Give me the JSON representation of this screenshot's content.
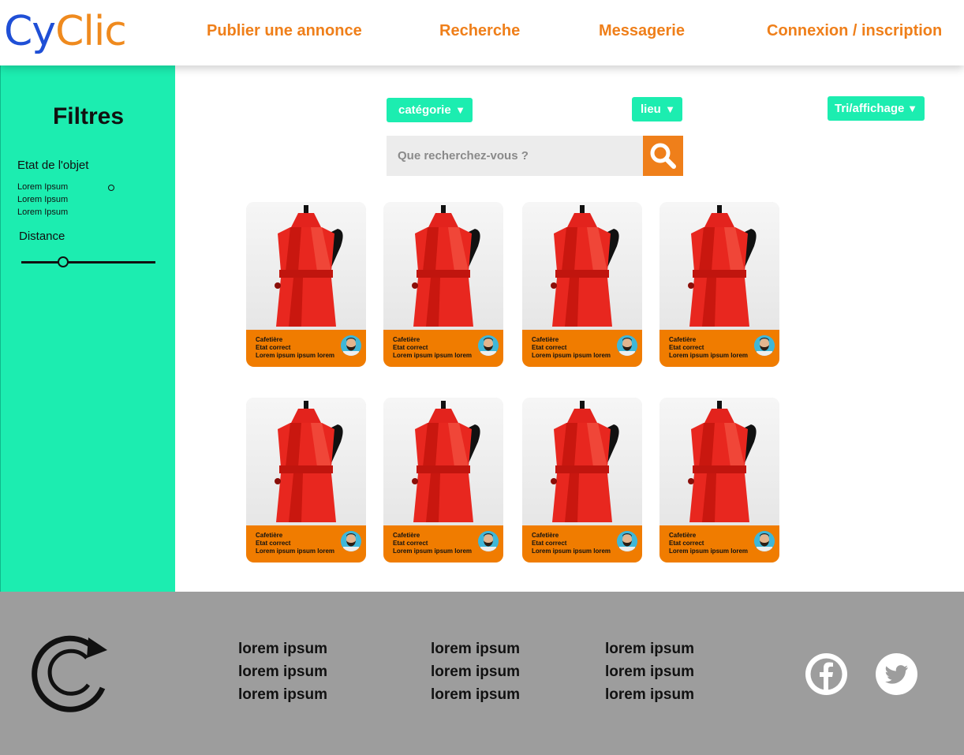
{
  "header": {
    "logo_cy": "Cy",
    "logo_clic": "Clic",
    "nav": [
      {
        "label": "Publier une annonce"
      },
      {
        "label": "Recherche"
      },
      {
        "label": "Messagerie"
      },
      {
        "label": "Connexion / inscription"
      }
    ]
  },
  "sidebar": {
    "title": "Filtres",
    "condition_label": "Etat de l'objet",
    "condition_options": [
      "Lorem Ipsum",
      "Lorem Ipsum",
      "Lorem Ipsum"
    ],
    "distance_label": "Distance",
    "distance_value": 0.31
  },
  "toolbar": {
    "category": "catégorie",
    "location": "lieu",
    "sort": "Tri/affichage"
  },
  "search": {
    "placeholder": "Que recherchez-vous ?"
  },
  "listings": [
    {
      "name": "Cafetière",
      "condition": "Etat correct",
      "desc": "Lorem ipsum ipsum lorem"
    },
    {
      "name": "Cafetière",
      "condition": "Etat correct",
      "desc": "Lorem ipsum ipsum lorem"
    },
    {
      "name": "Cafetière",
      "condition": "Etat correct",
      "desc": "Lorem ipsum ipsum lorem"
    },
    {
      "name": "Cafetière",
      "condition": "Etat correct",
      "desc": "Lorem ipsum ipsum lorem"
    },
    {
      "name": "Cafetière",
      "condition": "Etat correct",
      "desc": "Lorem ipsum ipsum lorem"
    },
    {
      "name": "Cafetière",
      "condition": "Etat correct",
      "desc": "Lorem ipsum ipsum lorem"
    },
    {
      "name": "Cafetière",
      "condition": "Etat correct",
      "desc": "Lorem ipsum ipsum lorem"
    },
    {
      "name": "Cafetière",
      "condition": "Etat correct",
      "desc": "Lorem ipsum ipsum lorem"
    }
  ],
  "footer": {
    "columns": [
      [
        "lorem ipsum",
        "lorem ipsum",
        "lorem ipsum"
      ],
      [
        "lorem ipsum",
        "lorem ipsum",
        "lorem ipsum"
      ],
      [
        "lorem ipsum",
        "lorem ipsum",
        "lorem ipsum"
      ]
    ],
    "social": [
      "facebook-icon",
      "twitter-icon"
    ]
  },
  "colors": {
    "accent_orange": "#ef7f1a",
    "sidebar_green": "#1cedb0",
    "logo_blue": "#1f4fd6",
    "footer_gray": "#9d9d9d"
  }
}
